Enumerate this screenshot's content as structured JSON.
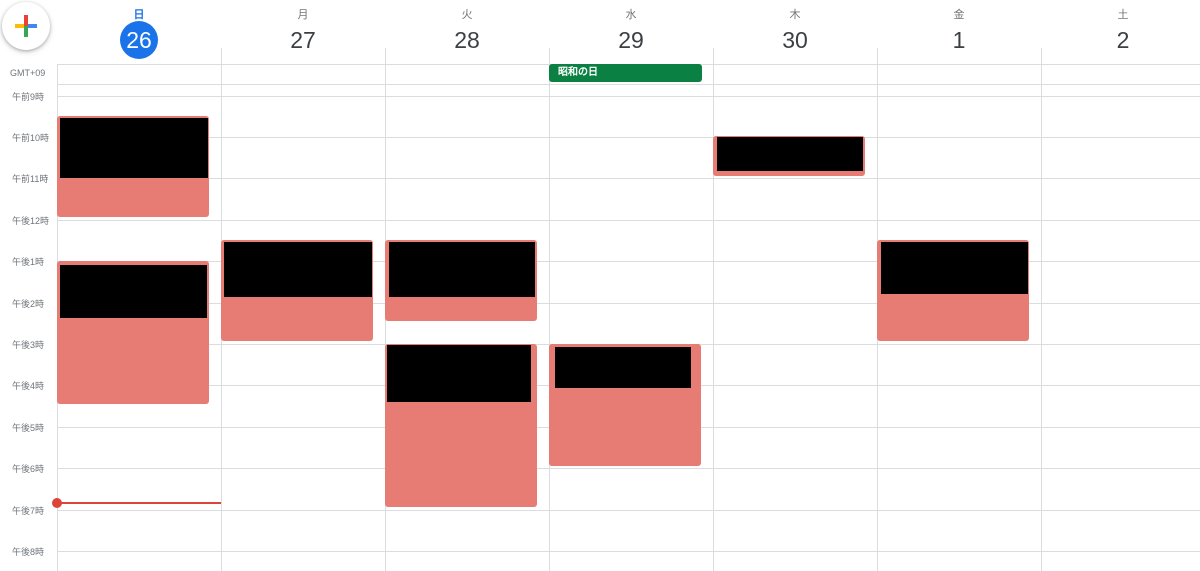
{
  "create_button": {
    "icon": "plus-icon"
  },
  "timezone": "GMT+09",
  "days": [
    {
      "name": "日",
      "date": "26",
      "today": true
    },
    {
      "name": "月",
      "date": "27"
    },
    {
      "name": "火",
      "date": "28"
    },
    {
      "name": "水",
      "date": "29"
    },
    {
      "name": "木",
      "date": "30"
    },
    {
      "name": "金",
      "date": "1"
    },
    {
      "name": "土",
      "date": "2"
    }
  ],
  "all_day_events": [
    {
      "day": "水",
      "title": "昭和の日",
      "color": "#0b8043"
    }
  ],
  "hours": [
    "午前9時",
    "午前10時",
    "午前11時",
    "午後12時",
    "午後1時",
    "午後2時",
    "午後3時",
    "午後4時",
    "午後5時",
    "午後6時",
    "午後7時",
    "午後8時"
  ],
  "event_color": "#e67c73",
  "events_note_hidden": "event titles redacted (black boxes)"
}
